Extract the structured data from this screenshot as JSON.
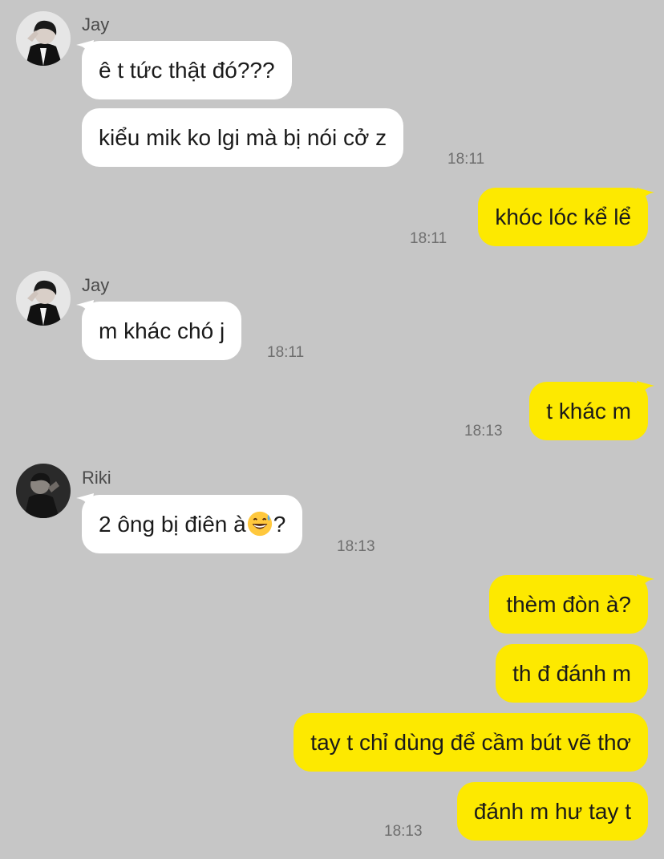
{
  "messages": {
    "jay_group1": {
      "sender": "Jay",
      "bubble1": "ê t tức thật đó???",
      "bubble2": "kiểu mik ko lgi mà bị nói cở z",
      "time": "18:11"
    },
    "me_1": {
      "text": "khóc lóc kể lể",
      "time": "18:11"
    },
    "jay_group2": {
      "sender": "Jay",
      "bubble1": "m khác chó j",
      "time": "18:11"
    },
    "me_2": {
      "text": "t khác m",
      "time": "18:13"
    },
    "riki_group": {
      "sender": "Riki",
      "bubble1_before": "2 ông bị điên à",
      "bubble1_emoji": "grinning-face-with-sweat-emoji",
      "bubble1_after": "?",
      "time": "18:13"
    },
    "me_3": {
      "bubble1": "thèm đòn à?",
      "bubble2": "th đ đánh m",
      "bubble3": "tay t chỉ dùng để cầm bút vẽ thơ",
      "bubble4": "đánh m hư tay t",
      "time": "18:13"
    }
  },
  "colors": {
    "background": "#c6c6c6",
    "incoming_bubble": "#ffffff",
    "outgoing_bubble": "#fde900"
  }
}
